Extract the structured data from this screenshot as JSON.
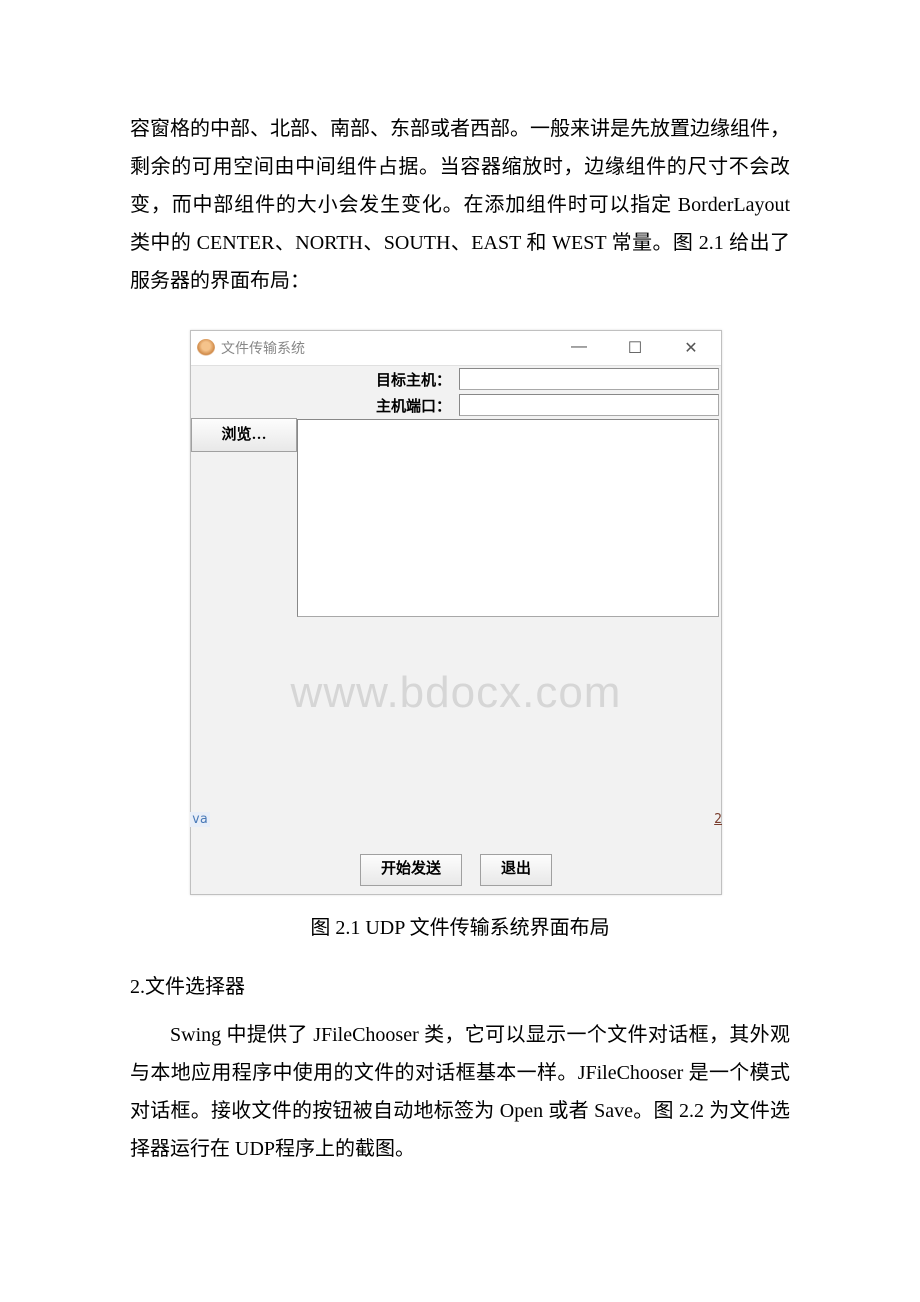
{
  "para1": "容窗格的中部、北部、南部、东部或者西部。一般来讲是先放置边缘组件，剩余的可用空间由中间组件占据。当容器缩放时，边缘组件的尺寸不会改变，而中部组件的大小会发生变化。在添加组件时可以指定 BorderLayout 类中的 CENTER、NORTH、SOUTH、EAST 和 WEST 常量。图 2.1 给出了服务器的界面布局：",
  "window": {
    "title": "文件传输系统",
    "labels": {
      "host": "目标主机：",
      "port": "主机端口："
    },
    "browse": "浏览…",
    "send": "开始发送",
    "exit": "退出",
    "watermark": "www.bdocx.com",
    "frag_left": "va",
    "frag_right": "2"
  },
  "caption": "图 2.1 UDP 文件传输系统界面布局",
  "section2": "2.文件选择器",
  "para2": "Swing 中提供了 JFileChooser 类，它可以显示一个文件对话框，其外观与本地应用程序中使用的文件的对话框基本一样。JFileChooser 是一个模式对话框。接收文件的按钮被自动地标签为 Open 或者 Save。图 2.2 为文件选择器运行在 UDP程序上的截图。"
}
